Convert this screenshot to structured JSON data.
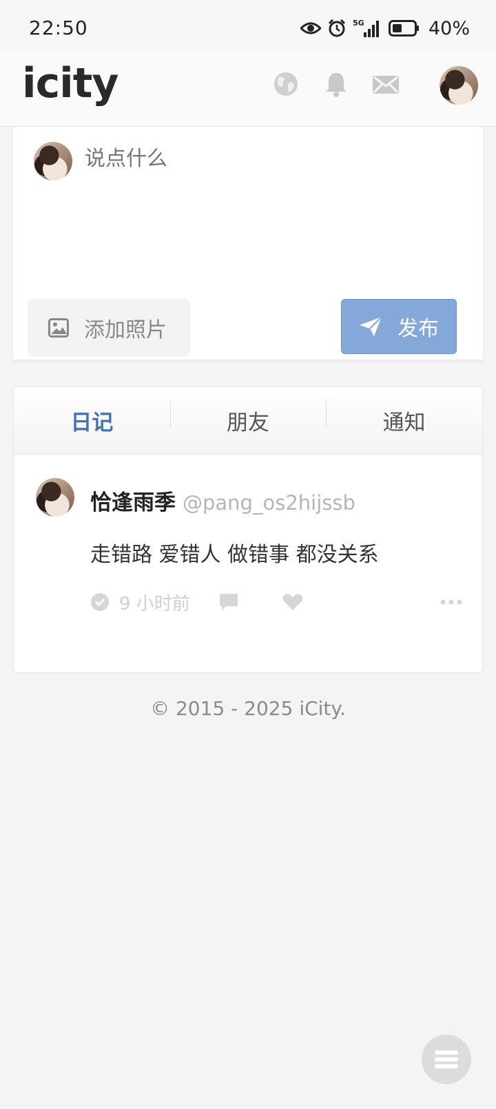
{
  "status_bar": {
    "time": "22:50",
    "network": "5G",
    "battery": "40%"
  },
  "header": {
    "logo": "icity",
    "icons": [
      "globe-icon",
      "bell-icon",
      "mail-icon"
    ]
  },
  "composer": {
    "placeholder": "说点什么",
    "add_photo_label": "添加照片",
    "publish_label": "发布",
    "publish_color": "#84a8d8"
  },
  "tabs": [
    {
      "label": "日记",
      "active": true
    },
    {
      "label": "朋友",
      "active": false
    },
    {
      "label": "通知",
      "active": false
    }
  ],
  "post": {
    "name": "恰逢雨季",
    "handle": "@pang_os2hijssb",
    "text": "走错路 爱错人 做错事 都没关系",
    "time": "9 小时前"
  },
  "footer": {
    "copyright": "© 2015 - 2025 iCity."
  },
  "colors": {
    "accent": "#4472b8",
    "background": "#f4f4f4"
  }
}
